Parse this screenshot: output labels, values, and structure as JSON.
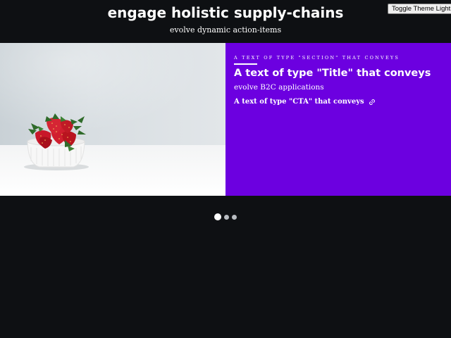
{
  "theme_toggle": {
    "label": "Toggle Theme Light"
  },
  "header": {
    "title": "engage holistic supply-chains",
    "subtitle": "evolve dynamic action-items"
  },
  "hero": {
    "image_alt": "Bowl of strawberries on a white table",
    "section_label": "A TEXT OF TYPE \"SECTION\" THAT CONVEYS",
    "title": "A text of type \"Title\" that conveys",
    "subtitle": "evolve B2C applications",
    "cta_label": "A text of type \"CTA\" that conveys",
    "cta_icon": "link-icon",
    "panel_color": "#6c00e0"
  },
  "carousel": {
    "slide_count": 3,
    "active_index": 0
  },
  "colors": {
    "background": "#0e1013",
    "accent": "#6c00e0"
  }
}
